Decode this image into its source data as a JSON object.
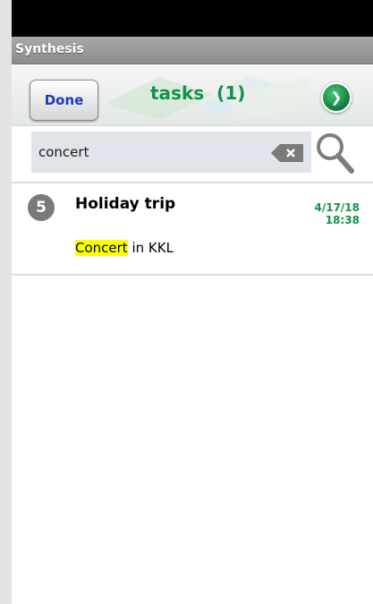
{
  "app": {
    "title": "Synthesis"
  },
  "header": {
    "done_label": "Done",
    "title": "tasks",
    "count": "(1)"
  },
  "search": {
    "value": "concert",
    "placeholder": ""
  },
  "tasks": [
    {
      "priority": "5",
      "title": "Holiday trip",
      "date": "4/17/18",
      "time": "18:38",
      "note_highlight": "Concert",
      "note_rest": " in KKL"
    }
  ],
  "colors": {
    "accent": "#129148",
    "done_text": "#1c38c4",
    "highlight": "#ffff00",
    "badge": "#7a7a7a"
  },
  "icons": {
    "clear": "backspace-clear-icon",
    "search": "magnifier-icon",
    "next": "arrow-right-circle-icon"
  }
}
